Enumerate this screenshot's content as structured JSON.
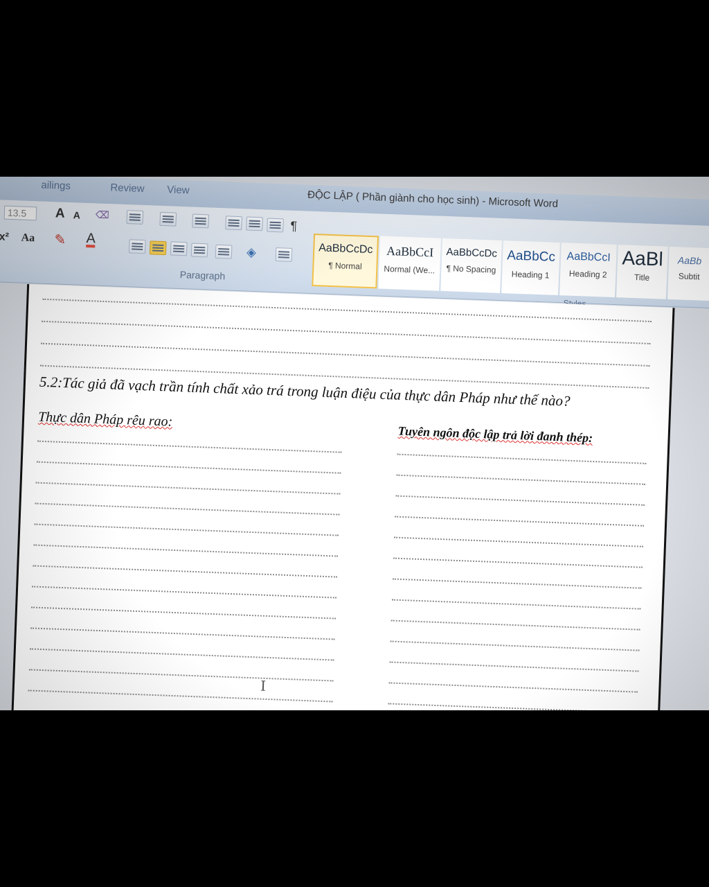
{
  "tabs": [
    {
      "label": "ailings"
    },
    {
      "label": "Review"
    },
    {
      "label": "View"
    }
  ],
  "window_title": "ĐỘC LẬP ( Phần giành cho học sinh) - Microsoft Word",
  "font": {
    "size": "13.5",
    "grow_label": "A",
    "shrink_label": "A",
    "superscript_label": "x²",
    "case_label": "Aa",
    "color_label": "A"
  },
  "groups": {
    "paragraph": "Paragraph",
    "styles": "Styles"
  },
  "styles": [
    {
      "preview": "AaBbCcDc",
      "name": "¶ Normal",
      "selected": true
    },
    {
      "preview": "AaBbCcI",
      "name": "Normal (We..."
    },
    {
      "preview": "AaBbCcDc",
      "name": "¶ No Spacing"
    },
    {
      "preview": "AaBbCc",
      "name": "Heading 1"
    },
    {
      "preview": "AaBbCcI",
      "name": "Heading 2"
    },
    {
      "preview": "AaBl",
      "name": "Title"
    },
    {
      "preview": "AaBb",
      "name": "Subtit"
    }
  ],
  "document": {
    "question": "5.2:Tác giả đã vạch trần  tính chất xảo trá trong luận điệu  của thực dân Pháp như thế nào?",
    "left_heading": "Thực dân Pháp rêu rao:",
    "right_heading": "Tuyên ngôn độc lập trả lời đanh thép:"
  },
  "colors": {
    "ribbon": "#d7e2ef",
    "highlight": "#f2c14a",
    "accent": "#e74c3c"
  }
}
